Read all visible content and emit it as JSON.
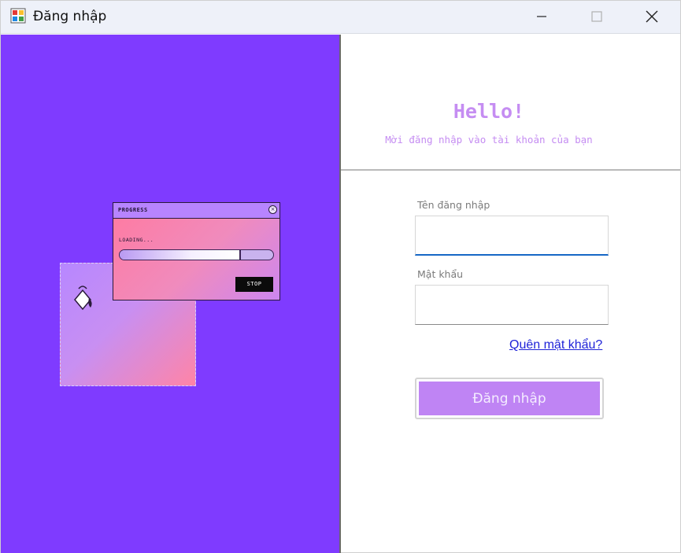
{
  "window": {
    "title": "Đăng nhập",
    "controls": {
      "minimize": "minimize",
      "maximize": "maximize",
      "close": "close"
    }
  },
  "illustration": {
    "window_title": "PROGRESS",
    "loading_text": "LOADING...",
    "progress_fraction": 0.79,
    "stop_label": "STOP",
    "background_color": "#7f3bff"
  },
  "header": {
    "greeting": "Hello!",
    "subtitle": "Mời đăng nhập vào tài khoản của bạn"
  },
  "form": {
    "username_label": "Tên đăng nhập",
    "username_value": "",
    "password_label": "Mật khẩu",
    "password_value": "",
    "forgot_link": "Quên mật khẩu?",
    "login_button": "Đăng nhập"
  },
  "colors": {
    "accent": "#c58df2",
    "button": "#bf84f4",
    "link": "#1f23d8",
    "focus": "#1667c6"
  }
}
